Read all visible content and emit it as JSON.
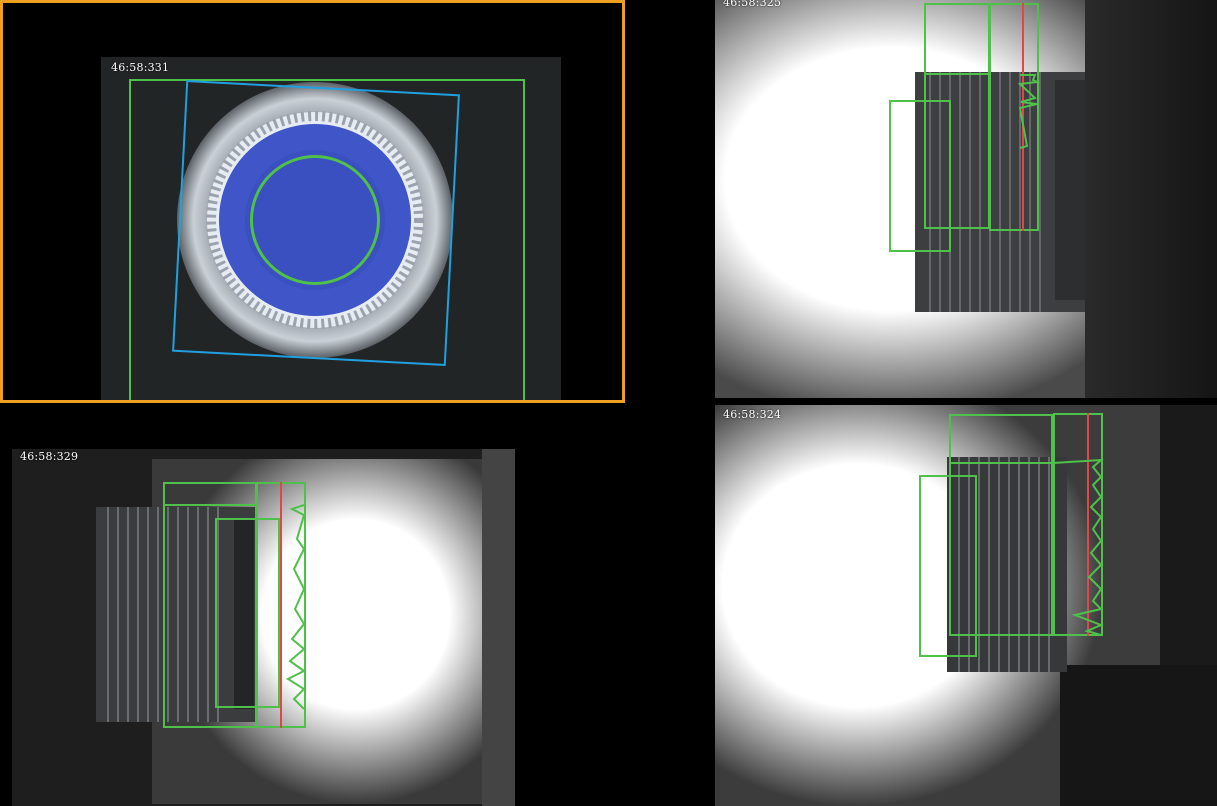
{
  "cameras": [
    {
      "id": "top-left",
      "timestamp": "46:58:331",
      "selected": true
    },
    {
      "id": "top-right",
      "timestamp": "46:58:325",
      "selected": false
    },
    {
      "id": "bottom-left",
      "timestamp": "46:58:329",
      "selected": false
    },
    {
      "id": "bottom-right",
      "timestamp": "46:58:324",
      "selected": false
    }
  ],
  "colors": {
    "selection_border": "#f0a020",
    "roi_green": "#4fc04a",
    "roi_cyan": "#20a0e0",
    "roi_blue": "#4450c8",
    "center_line_red": "#e04848",
    "cap_fill_blue": "#3f55c8"
  }
}
